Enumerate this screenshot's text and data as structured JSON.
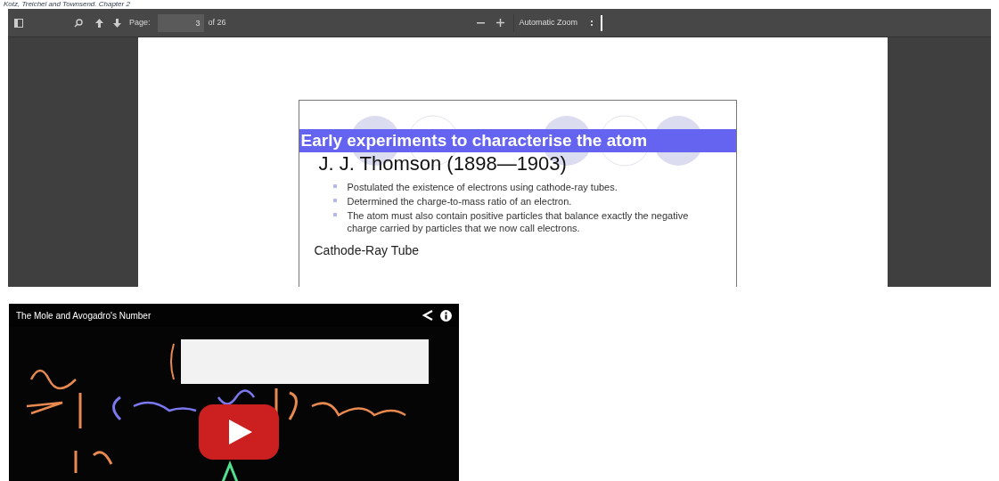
{
  "caption": "Kotz, Treichel and Townsend. Chapter 2",
  "pdf_viewer": {
    "toolbar": {
      "page_label": "Page:",
      "page_number": "3",
      "page_count": "of 26",
      "zoom": "Automatic Zoom"
    },
    "slide": {
      "title": "Early experiments to characterise the atom",
      "heading": "J. J. Thomson (1898—1903)",
      "bullets": [
        "Postulated the existence of electrons using cathode-ray tubes.",
        "Determined the charge-to-mass ratio of an electron.",
        "The atom must also contain positive particles that balance exactly the negative charge carried by particles that we now call electrons."
      ],
      "subheading": "Cathode-Ray Tube"
    }
  },
  "video": {
    "title": "The Mole and Avogadro's Number"
  }
}
